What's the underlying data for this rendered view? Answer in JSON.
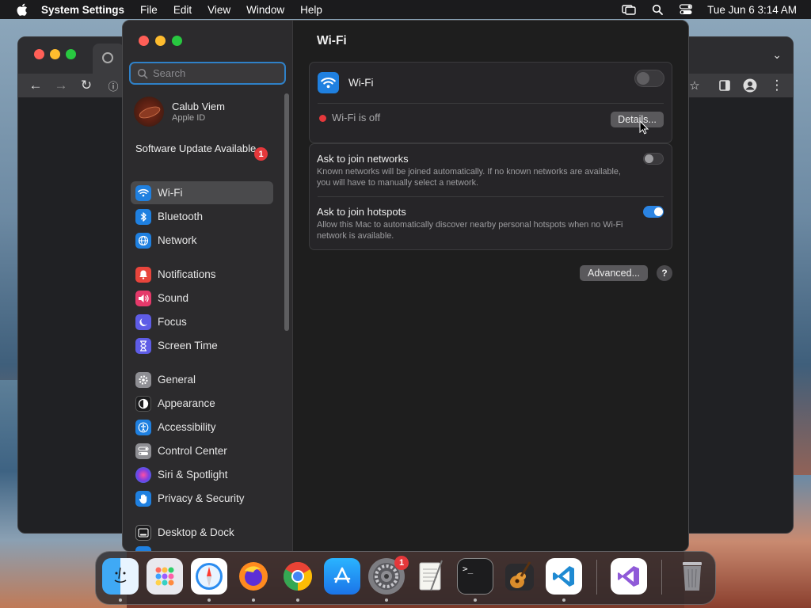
{
  "menubar": {
    "app_name": "System Settings",
    "menus": [
      "File",
      "Edit",
      "View",
      "Window",
      "Help"
    ],
    "clock": "Tue Jun 6  3:14 AM"
  },
  "sidebar": {
    "search_placeholder": "Search",
    "account": {
      "name": "Calub Viem",
      "subtitle": "Apple ID"
    },
    "software_update": {
      "label": "Software Update Available",
      "badge": "1"
    },
    "items": [
      {
        "label": "Wi-Fi",
        "icon": "wifi-icon",
        "color": "#1f80e0",
        "selected": true
      },
      {
        "label": "Bluetooth",
        "icon": "bluetooth-icon",
        "color": "#1f80e0"
      },
      {
        "label": "Network",
        "icon": "globe-icon",
        "color": "#1f80e0"
      },
      {
        "label": "Notifications",
        "icon": "bell-icon",
        "color": "#e8453c"
      },
      {
        "label": "Sound",
        "icon": "speaker-icon",
        "color": "#e5396a"
      },
      {
        "label": "Focus",
        "icon": "moon-icon",
        "color": "#5e5ce6"
      },
      {
        "label": "Screen Time",
        "icon": "hourglass-icon",
        "color": "#5e5ce6"
      },
      {
        "label": "General",
        "icon": "gear-icon",
        "color": "#8e8e93"
      },
      {
        "label": "Appearance",
        "icon": "appearance-icon",
        "color": "#1c1c1e"
      },
      {
        "label": "Accessibility",
        "icon": "accessibility-icon",
        "color": "#1f80e0"
      },
      {
        "label": "Control Center",
        "icon": "control-center-icon",
        "color": "#8e8e93"
      },
      {
        "label": "Siri & Spotlight",
        "icon": "siri-icon",
        "color": "#b543c9"
      },
      {
        "label": "Privacy & Security",
        "icon": "hand-icon",
        "color": "#1f80e0"
      },
      {
        "label": "Desktop & Dock",
        "icon": "dock-icon",
        "color": "#1c1c1e"
      }
    ]
  },
  "main": {
    "title": "Wi-Fi",
    "wifi": {
      "label": "Wi-Fi",
      "enabled": false,
      "status": "Wi-Fi is off",
      "details_button": "Details..."
    },
    "ask_networks": {
      "title": "Ask to join networks",
      "description": "Known networks will be joined automatically. If no known networks are available, you will have to manually select a network.",
      "enabled": false
    },
    "ask_hotspots": {
      "title": "Ask to join hotspots",
      "description": "Allow this Mac to automatically discover nearby personal hotspots when no Wi-Fi network is available.",
      "enabled": true
    },
    "advanced_button": "Advanced...",
    "help_button": "?"
  },
  "dock": {
    "apps": [
      "Finder",
      "Launchpad",
      "Safari",
      "Firefox",
      "Chrome",
      "App Store",
      "System Settings",
      "TextEdit",
      "Terminal",
      "GarageBand",
      "Visual Studio Code",
      "Visual Studio",
      "Trash"
    ],
    "settings_badge": "1"
  },
  "colors": {
    "accent": "#2b84e3",
    "badge": "#e5383b",
    "status_off": "#e5383b"
  }
}
